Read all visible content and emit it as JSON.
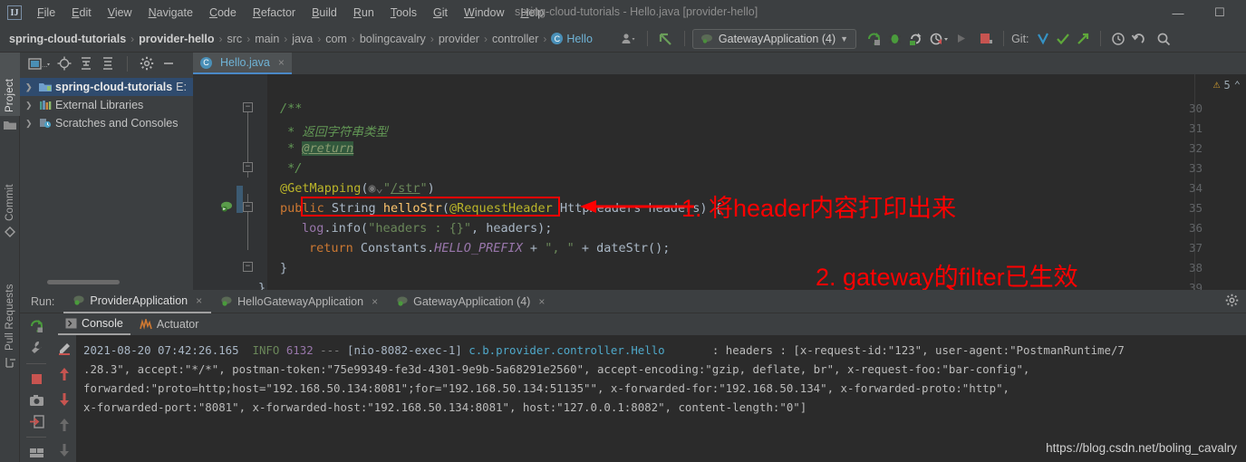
{
  "window": {
    "title": "spring-cloud-tutorials - Hello.java [provider-hello]",
    "logo": "IJ",
    "minimize": "—",
    "maximize": "☐"
  },
  "menu": [
    {
      "label": "File"
    },
    {
      "label": "Edit"
    },
    {
      "label": "View"
    },
    {
      "label": "Navigate"
    },
    {
      "label": "Code"
    },
    {
      "label": "Refactor"
    },
    {
      "label": "Build"
    },
    {
      "label": "Run"
    },
    {
      "label": "Tools"
    },
    {
      "label": "Git"
    },
    {
      "label": "Window"
    },
    {
      "label": "Help"
    }
  ],
  "breadcrumb": {
    "items": [
      "spring-cloud-tutorials",
      "provider-hello",
      "src",
      "main",
      "java",
      "com",
      "bolingcavalry",
      "provider",
      "controller"
    ],
    "class_badge": "C",
    "class_name": "Hello",
    "separator": "›"
  },
  "toolbar": {
    "run_config": "GatewayApplication (4)",
    "git_label": "Git:",
    "icons": [
      "user-icon",
      "back-arrow-icon",
      "run-config-icon",
      "rerun-icon",
      "debug-icon",
      "coverage-icon",
      "profile-icon",
      "run-icon",
      "stop-icon",
      "git-update-icon",
      "git-commit-icon",
      "git-push-icon",
      "history-icon",
      "undo-icon",
      "search-icon"
    ]
  },
  "left_strip": [
    {
      "label": "Project",
      "selected": true,
      "icon": "project-icon"
    },
    {
      "label": "Commit",
      "selected": false,
      "icon": "commit-icon"
    },
    {
      "label": "Pull Requests",
      "selected": false,
      "icon": "pull-requests-icon"
    }
  ],
  "project_panel": {
    "toolbar_icons": [
      "project-view-icon",
      "locate-icon",
      "expand-all-icon",
      "collapse-all-icon",
      "settings-icon",
      "hide-icon"
    ],
    "tree": [
      {
        "label": "spring-cloud-tutorials",
        "suffix": "E:",
        "selected": true,
        "bold": true,
        "icon": "module-icon"
      },
      {
        "label": "External Libraries",
        "suffix": "",
        "selected": false,
        "bold": false,
        "icon": "libraries-icon"
      },
      {
        "label": "Scratches and Consoles",
        "suffix": "",
        "selected": false,
        "bold": false,
        "icon": "scratches-icon"
      }
    ]
  },
  "editor": {
    "tab": {
      "label": "Hello.java",
      "badge": "C",
      "close": "×"
    },
    "inspection": {
      "warning_count": "5",
      "chevron": "⌃"
    },
    "lines": [
      {
        "num": "30",
        "text": "/**"
      },
      {
        "num": "31",
        "text": "* 返回字符串类型"
      },
      {
        "num": "32",
        "text": "* @return"
      },
      {
        "num": "33",
        "text": "*/"
      },
      {
        "num": "34",
        "text": "@GetMapping(\"/str\")"
      },
      {
        "num": "35",
        "text": "public String helloStr(@RequestHeader HttpHeaders headers) {"
      },
      {
        "num": "36",
        "text": "log.info(\"headers : {}\", headers);"
      },
      {
        "num": "37",
        "text": "return Constants.HELLO_PREFIX + \", \" + dateStr();"
      },
      {
        "num": "38",
        "text": "}"
      },
      {
        "num": "39",
        "text": "}"
      }
    ]
  },
  "annotations": [
    {
      "id": "anno-1",
      "text": "1. 将header内容打印出来",
      "color": "#ff0000"
    },
    {
      "id": "anno-2",
      "text": "2. gateway的filter已生效",
      "color": "#ff0000"
    }
  ],
  "run_window": {
    "label": "Run:",
    "tabs": [
      {
        "label": "ProviderApplication",
        "selected": true,
        "close": "×"
      },
      {
        "label": "HelloGatewayApplication",
        "selected": false,
        "close": "×"
      },
      {
        "label": "GatewayApplication (4)",
        "selected": false,
        "close": "×"
      }
    ],
    "sub_tabs": [
      {
        "label": "Console",
        "selected": true,
        "icon": "console-icon"
      },
      {
        "label": "Actuator",
        "selected": false,
        "icon": "actuator-icon"
      }
    ],
    "settings_icon": "gear-icon",
    "left_tools": [
      "rerun-icon",
      "wrench-icon",
      "stop-icon",
      "camera-icon",
      "export-icon",
      "layout-icon"
    ],
    "console_tools": [
      "soft-wrap-icon",
      "scroll-up-icon",
      "scroll-down-icon",
      "prev-icon",
      "next-icon"
    ]
  },
  "console": {
    "line1": {
      "timestamp": "2021-08-20 07:42:26.165",
      "level": "INFO",
      "pid": "6132",
      "dashes": "---",
      "thread": "[nio-8082-exec-1]",
      "logger": "c.b.provider.controller.Hello",
      "message": ": headers : [x-request-id:\"123\", user-agent:\"PostmanRuntime/7"
    },
    "line2": ".28.3\", accept:\"*/*\", postman-token:\"75e99349-fe3d-4301-9e9b-5a68291e2560\", accept-encoding:\"gzip, deflate, br\", x-request-foo:\"bar-config\",",
    "line3": "forwarded:\"proto=http;host=\"192.168.50.134:8081\";for=\"192.168.50.134:51135\"\", x-forwarded-for:\"192.168.50.134\", x-forwarded-proto:\"http\",",
    "line4": "x-forwarded-port:\"8081\", x-forwarded-host:\"192.168.50.134:8081\", host:\"127.0.0.1:8082\", content-length:\"0\"]"
  },
  "watermark": "https://blog.csdn.net/boling_cavalry",
  "colors": {
    "accent_red": "#ff0000",
    "editor_bg": "#2b2b2b",
    "chrome_bg": "#3c3f41",
    "selection_blue": "#2f4b6e",
    "warning_yellow": "#d9a22e"
  }
}
